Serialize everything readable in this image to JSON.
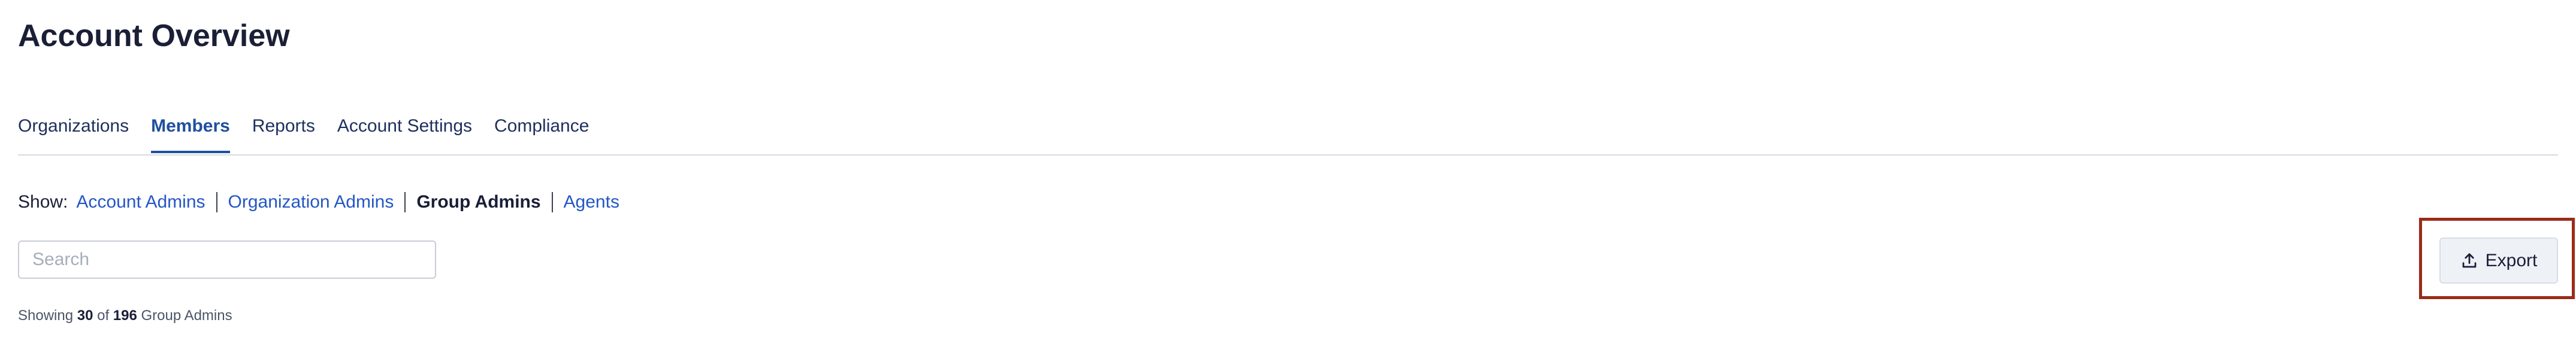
{
  "page": {
    "title": "Account Overview"
  },
  "tabs": [
    {
      "label": "Organizations",
      "active": false
    },
    {
      "label": "Members",
      "active": true
    },
    {
      "label": "Reports",
      "active": false
    },
    {
      "label": "Account Settings",
      "active": false
    },
    {
      "label": "Compliance",
      "active": false
    }
  ],
  "filter": {
    "label": "Show:",
    "options": [
      {
        "label": "Account Admins",
        "selected": false
      },
      {
        "label": "Organization Admins",
        "selected": false
      },
      {
        "label": "Group Admins",
        "selected": true
      },
      {
        "label": "Agents",
        "selected": false
      }
    ]
  },
  "search": {
    "placeholder": "Search",
    "value": ""
  },
  "export": {
    "label": "Export",
    "icon": "upload-icon"
  },
  "results": {
    "prefix": "Showing",
    "shown": "30",
    "of": "of",
    "total": "196",
    "noun": "Group Admins"
  },
  "colors": {
    "accent": "#1f4fa0",
    "link": "#2456c6",
    "highlight_frame": "#9b2a18"
  }
}
